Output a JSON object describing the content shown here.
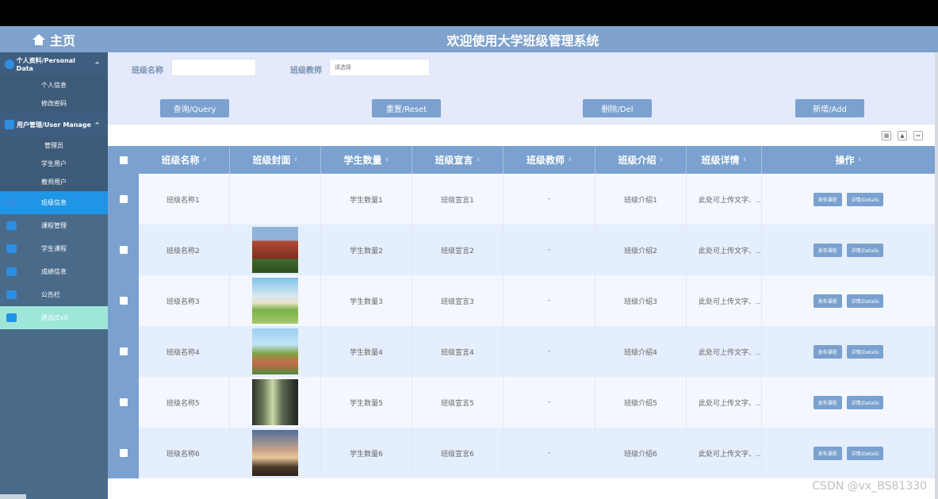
{
  "header": {
    "home_label": "主页",
    "title": "欢迎使用大学班级管理系统"
  },
  "sidebar": {
    "groups": [
      {
        "label": "个人资料/Personal Data",
        "items": [
          "个人信息",
          "修改密码"
        ]
      },
      {
        "label": "用户管理/User Manage",
        "items": [
          "管理员",
          "学生用户",
          "教师用户"
        ]
      }
    ],
    "nav": [
      {
        "label": "班级信息",
        "active": true
      },
      {
        "label": "课程管理",
        "active": false
      },
      {
        "label": "学生课程",
        "active": false
      },
      {
        "label": "成绩信息",
        "active": false
      },
      {
        "label": "公告栏",
        "active": false
      },
      {
        "label": "退出/Exit",
        "active": false
      }
    ]
  },
  "search": {
    "class_name_label": "班级名称",
    "class_name_value": "",
    "teacher_label": "班级教师",
    "teacher_placeholder": "请选择"
  },
  "buttons": {
    "query": "查询/Query",
    "reset": "重置/Reset",
    "delete": "删除/Del",
    "add": "新增/Add"
  },
  "table": {
    "columns": [
      "班级名称",
      "班级封面",
      "学生数量",
      "班级宣言",
      "班级教师",
      "班级介绍",
      "班级详情",
      "操作"
    ],
    "sort_icon": "sort-icon",
    "rows": [
      {
        "name": "班级名称1",
        "cover": null,
        "count": "学生数量1",
        "slogan": "班级宣言1",
        "teacher": "-",
        "intro": "班级介绍1",
        "details": "此处可上传文字、..."
      },
      {
        "name": "班级名称2",
        "cover": "brick-building",
        "count": "学生数量2",
        "slogan": "班级宣言2",
        "teacher": "-",
        "intro": "班级介绍2",
        "details": "此处可上传文字、..."
      },
      {
        "name": "班级名称3",
        "cover": "anime-school",
        "count": "学生数量3",
        "slogan": "班级宣言3",
        "teacher": "-",
        "intro": "班级介绍3",
        "details": "此处可上传文字、..."
      },
      {
        "name": "班级名称4",
        "cover": "sports-field",
        "count": "学生数量4",
        "slogan": "班级宣言4",
        "teacher": "-",
        "intro": "班级介绍4",
        "details": "此处可上传文字、..."
      },
      {
        "name": "班级名称5",
        "cover": "library-hall",
        "count": "学生数量5",
        "slogan": "班级宣言5",
        "teacher": "-",
        "intro": "班级介绍5",
        "details": "此处可上传文字、..."
      },
      {
        "name": "班级名称6",
        "cover": "sunset-campus",
        "count": "学生数量6",
        "slogan": "班级宣言6",
        "teacher": "-",
        "intro": "班级介绍6",
        "details": "此处可上传文字、..."
      }
    ],
    "op_publish": "发布课程",
    "op_details": "详情/Details"
  },
  "watermark": "CSDN @vx_BS81330",
  "colors": {
    "accent": "#7aa1cf",
    "sidebar": "#4a6a8a",
    "active": "#1f95e6",
    "exit": "#9ee7d8"
  }
}
